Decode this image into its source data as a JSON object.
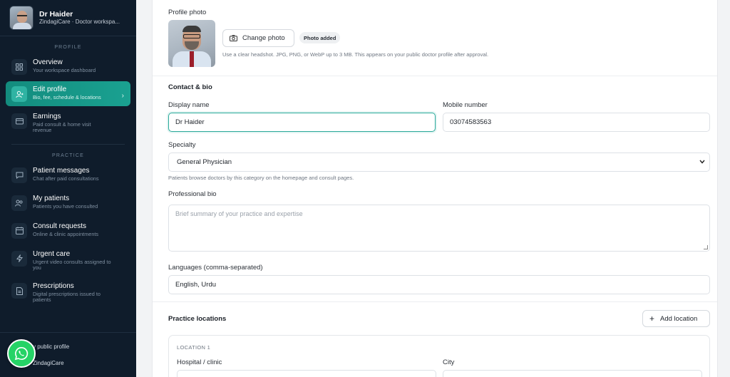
{
  "sidebar": {
    "user": {
      "name": "Dr Haider",
      "subtitle": "ZindagiCare · Doctor workspa..."
    },
    "sections": {
      "profile": "PROFILE",
      "practice": "PRACTICE"
    },
    "items": [
      {
        "label": "Overview",
        "desc": "Your workspace dashboard",
        "icon": "grid-icon"
      },
      {
        "label": "Edit profile",
        "desc": "Bio, fee, schedule & locations",
        "icon": "user-edit-icon"
      },
      {
        "label": "Earnings",
        "desc": "Paid consult & home visit revenue",
        "icon": "wallet-icon"
      },
      {
        "label": "Patient messages",
        "desc": "Chat after paid consultations",
        "icon": "chat-icon"
      },
      {
        "label": "My patients",
        "desc": "Patients you have consulted",
        "icon": "users-icon"
      },
      {
        "label": "Consult requests",
        "desc": "Online & clinic appointments",
        "icon": "calendar-icon"
      },
      {
        "label": "Urgent care",
        "desc": "Urgent video consults assigned to you",
        "icon": "bolt-icon"
      },
      {
        "label": "Prescriptions",
        "desc": "Digital prescriptions issued to patients",
        "icon": "document-icon"
      }
    ],
    "bottom_links": [
      "y public profile",
      "ZindagiCare"
    ]
  },
  "profile_photo": {
    "label": "Profile photo",
    "change_button": "Change photo",
    "status_badge": "Photo added",
    "hint": "Use a clear headshot. JPG, PNG, or WebP up to 3 MB. This appears on your public doctor profile after approval."
  },
  "contact": {
    "heading": "Contact & bio",
    "display_name_label": "Display name",
    "display_name_value": "Dr Haider",
    "mobile_label": "Mobile number",
    "mobile_value": "03074583563",
    "specialty_label": "Specialty",
    "specialty_value": "General Physician",
    "specialty_hint": "Patients browse doctors by this category on the homepage and consult pages.",
    "bio_label": "Professional bio",
    "bio_placeholder": "Brief summary of your practice and expertise",
    "languages_label": "Languages (comma-separated)",
    "languages_value": "English, Urdu"
  },
  "locations": {
    "heading": "Practice locations",
    "add_button": "Add location",
    "location_title": "LOCATION 1",
    "hospital_label": "Hospital / clinic",
    "city_label": "City"
  }
}
